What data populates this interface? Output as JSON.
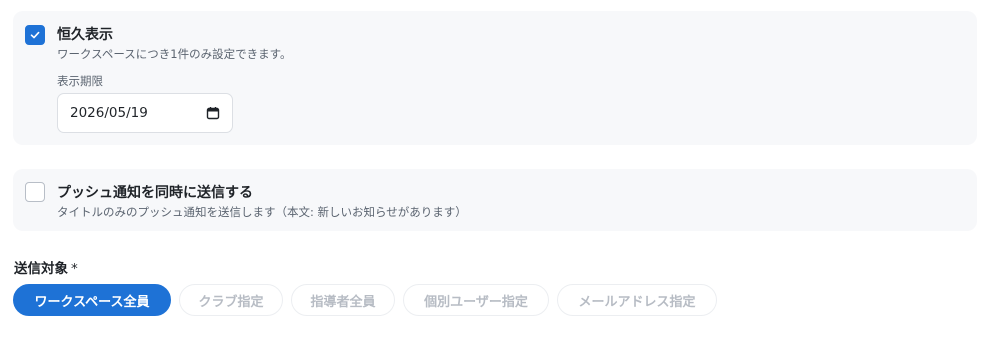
{
  "persistent_option": {
    "checked": true,
    "title": "恒久表示",
    "description": "ワークスペースにつき1件のみ設定できます。",
    "date_label": "表示期限",
    "date_value": "2026/05/19",
    "check_icon": "check-icon",
    "calendar_icon": "calendar-icon"
  },
  "push_option": {
    "checked": false,
    "title": "プッシュ通知を同時に送信する",
    "description": "タイトルのみのプッシュ通知を送信します（本文: 新しいお知らせがあります）"
  },
  "target": {
    "label": "送信対象",
    "required_mark": "*",
    "options": [
      {
        "label": "ワークスペース全員",
        "selected": true
      },
      {
        "label": "クラブ指定",
        "selected": false
      },
      {
        "label": "指導者全員",
        "selected": false
      },
      {
        "label": "個別ユーザー指定",
        "selected": false
      },
      {
        "label": "メールアドレス指定",
        "selected": false
      }
    ]
  },
  "colors": {
    "accent": "#1e72d6",
    "card_background": "#f7f8fa",
    "muted_text": "#5b6470",
    "disabled_chip_text": "#b7bcc4"
  }
}
